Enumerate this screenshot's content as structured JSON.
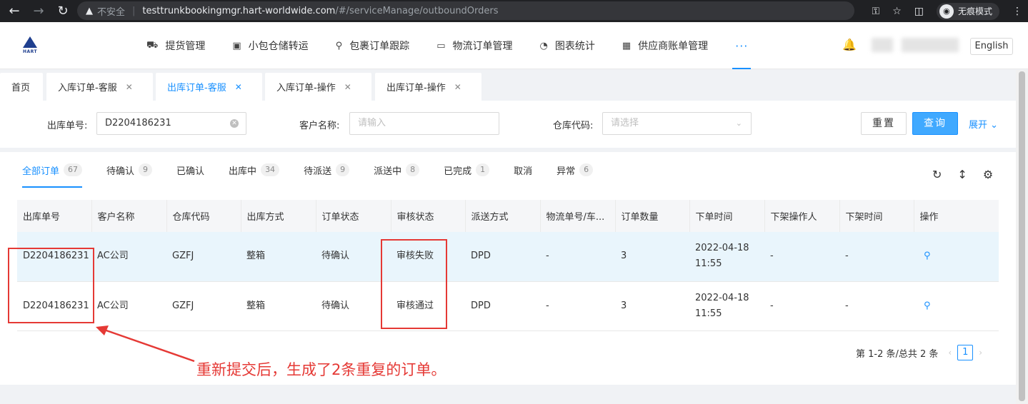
{
  "browser": {
    "insecure_label": "不安全",
    "url_host": "testtrunkbookingmgr.hart-worldwide.com",
    "url_path": "/#/serviceManage/outboundOrders",
    "incognito_label": "无痕模式"
  },
  "header": {
    "logo_text": "HART",
    "nav": [
      {
        "label": "提货管理",
        "icon": "truck-icon"
      },
      {
        "label": "小包仓储转运",
        "icon": "box-icon"
      },
      {
        "label": "包裹订单跟踪",
        "icon": "search-icon"
      },
      {
        "label": "物流订单管理",
        "icon": "folder-icon"
      },
      {
        "label": "图表统计",
        "icon": "pie-chart-icon"
      },
      {
        "label": "供应商账单管理",
        "icon": "calendar-icon"
      }
    ],
    "more_label": "···",
    "language_button": "English"
  },
  "tabs": [
    {
      "label": "首页",
      "closable": false
    },
    {
      "label": "入库订单-客服",
      "closable": true
    },
    {
      "label": "出库订单-客服",
      "closable": true,
      "active": true
    },
    {
      "label": "入库订单-操作",
      "closable": true
    },
    {
      "label": "出库订单-操作",
      "closable": true
    }
  ],
  "filters": {
    "order_no_label": "出库单号:",
    "order_no_value": "D2204186231",
    "customer_label": "客户名称:",
    "customer_placeholder": "请输入",
    "warehouse_label": "仓库代码:",
    "warehouse_placeholder": "请选择",
    "reset_button": "重置",
    "query_button": "查询",
    "expand_label": "展开"
  },
  "status_tabs": [
    {
      "label": "全部订单",
      "count": "67",
      "active": true
    },
    {
      "label": "待确认",
      "count": "9"
    },
    {
      "label": "已确认",
      "count": ""
    },
    {
      "label": "出库中",
      "count": "34"
    },
    {
      "label": "待派送",
      "count": "9"
    },
    {
      "label": "派送中",
      "count": "8"
    },
    {
      "label": "已完成",
      "count": "1"
    },
    {
      "label": "取消",
      "count": ""
    },
    {
      "label": "异常",
      "count": "6"
    }
  ],
  "table": {
    "columns": [
      "出库单号",
      "客户名称",
      "仓库代码",
      "出库方式",
      "订单状态",
      "审核状态",
      "派送方式",
      "物流单号/车...",
      "订单数量",
      "下单时间",
      "下架操作人",
      "下架时间",
      "操作"
    ],
    "rows": [
      {
        "order_no": "D2204186231",
        "customer": "AC公司",
        "warehouse": "GZFJ",
        "method": "整箱",
        "status": "待确认",
        "audit": "审核失败",
        "delivery": "DPD",
        "tracking": "-",
        "qty": "3",
        "time_date": "2022-04-18",
        "time_clock": "11:55",
        "operator": "-",
        "off_time": "-"
      },
      {
        "order_no": "D2204186231",
        "customer": "AC公司",
        "warehouse": "GZFJ",
        "method": "整箱",
        "status": "待确认",
        "audit": "审核通过",
        "delivery": "DPD",
        "tracking": "-",
        "qty": "3",
        "time_date": "2022-04-18",
        "time_clock": "11:55",
        "operator": "-",
        "off_time": "-"
      }
    ]
  },
  "pagination": {
    "summary": "第 1-2 条/总共 2 条",
    "current_page": "1"
  },
  "annotation": {
    "note": "重新提交后，生成了2条重复的订单。",
    "color": "#e53935"
  }
}
